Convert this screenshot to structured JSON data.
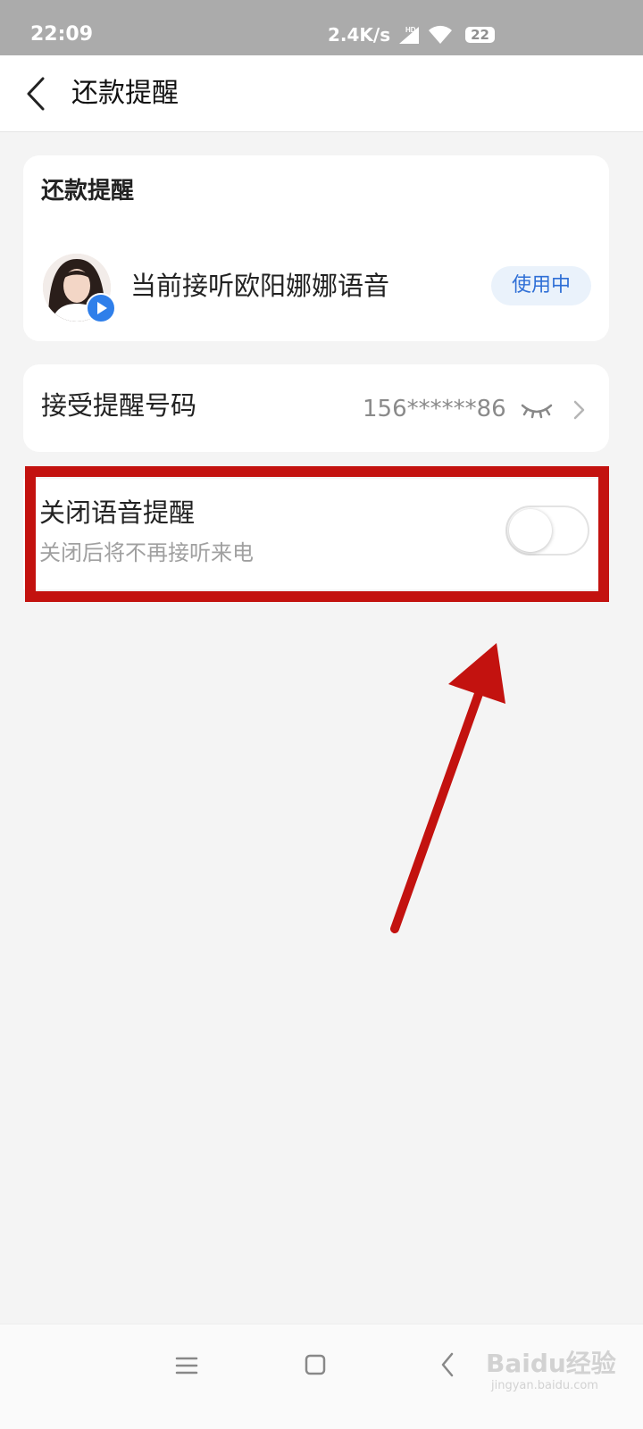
{
  "status_bar": {
    "time": "22:09",
    "speed": "2.4K/s",
    "battery": "22"
  },
  "header": {
    "title": "还款提醒"
  },
  "voice_card": {
    "title": "还款提醒",
    "voice_text": "当前接听欧阳娜娜语音",
    "status_badge": "使用中"
  },
  "phone_card": {
    "label": "接受提醒号码",
    "number": "156******86"
  },
  "voice_toggle_card": {
    "label": "关闭语音提醒",
    "sublabel": "关闭后将不再接听来电",
    "toggle_on": false
  },
  "watermark": {
    "logo": "Baidu经验",
    "url": "jingyan.baidu.com"
  },
  "colors": {
    "accent_blue": "#2f6fd6",
    "highlight_red": "#c3120f",
    "status_bar": "#ababab",
    "background": "#f4f4f4"
  },
  "icons": [
    "back-arrow-icon",
    "signal-icon",
    "wifi-icon",
    "play-icon",
    "eye-closed-icon",
    "chevron-right-icon",
    "menu-icon",
    "home-icon",
    "nav-back-icon"
  ]
}
